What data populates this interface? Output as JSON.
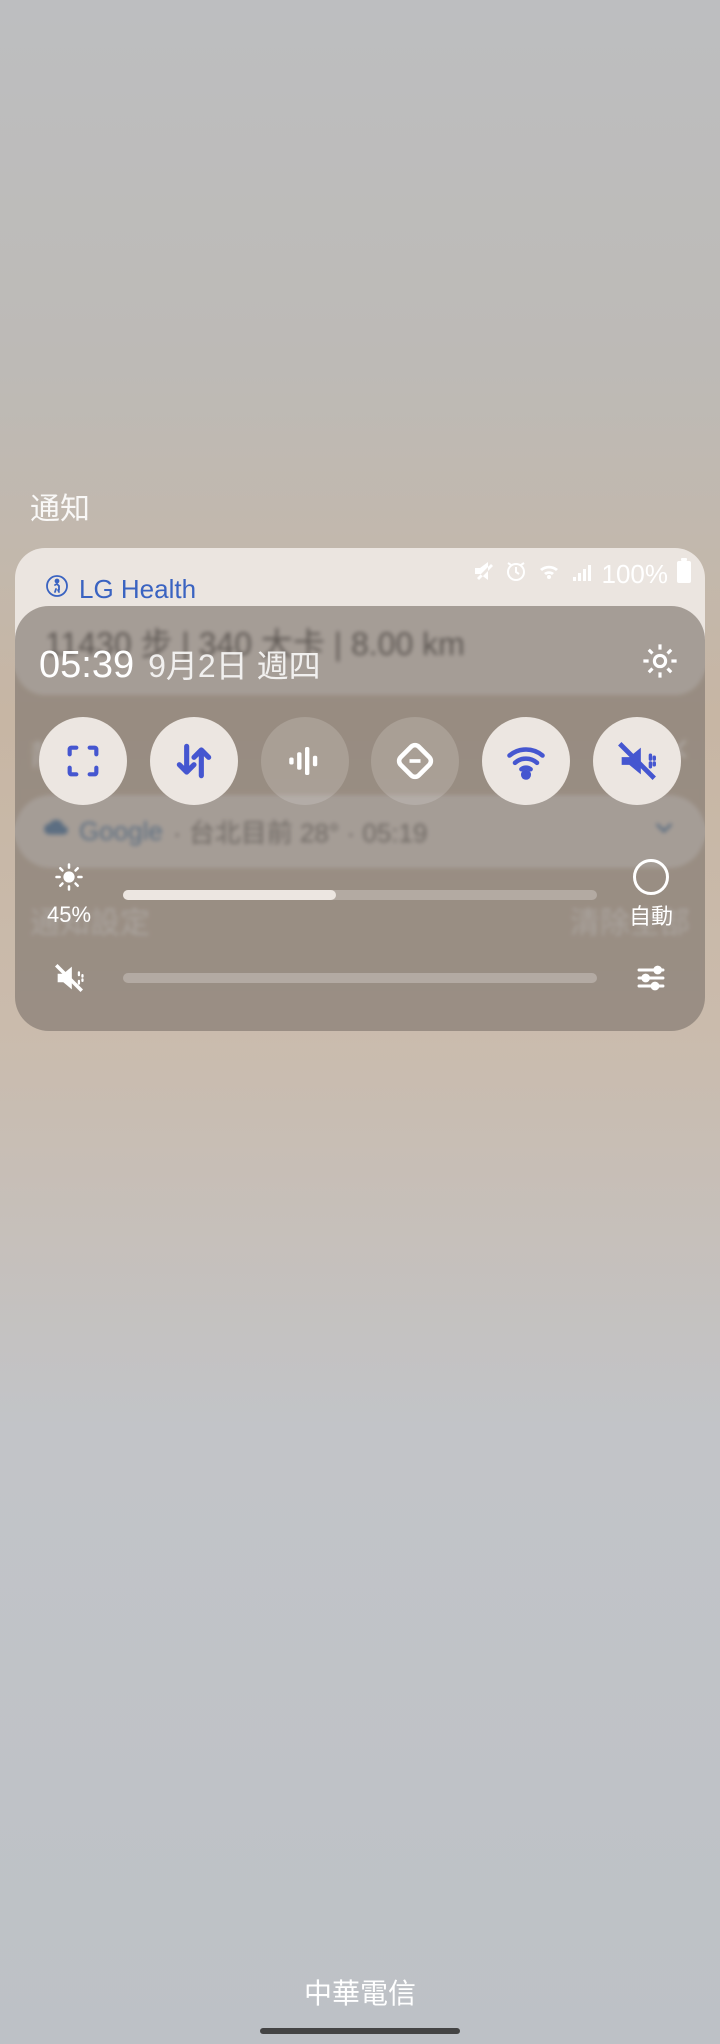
{
  "status": {
    "battery": "100%"
  },
  "qs": {
    "time": "05:39",
    "date": "9月2日 週四",
    "brightness": {
      "label": "45%",
      "auto_label": "自動",
      "fill_percent": 45
    }
  },
  "sections": {
    "notifications": "通知",
    "muted": "靜音"
  },
  "lg_health": {
    "app_name": "LG Health",
    "summary": "11430 步 | 340 大卡 | 8.00 km"
  },
  "google": {
    "app_name": "Google",
    "summary": " · 台北目前 28° · 05:19"
  },
  "actions": {
    "settings": "通知設定",
    "clear_all": "清除全部"
  },
  "carrier": "中華電信"
}
